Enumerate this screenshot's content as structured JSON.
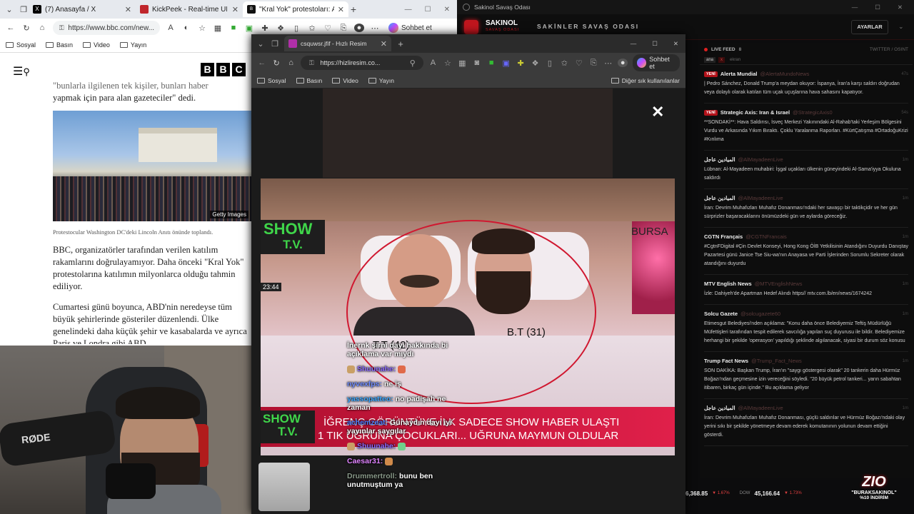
{
  "bbc_window": {
    "tabs": [
      {
        "label": "(7) Anasayfa / X"
      },
      {
        "label": "KickPeek - Real-time URL Crawl"
      },
      {
        "label": "\"Kral Yok\" protestoları: ABD ge"
      }
    ],
    "url": "https://www.bbc.com/new...",
    "sohbet": "Sohbet et",
    "bookmarks": [
      "Sosyal",
      "Basın",
      "Video",
      "Yayın"
    ],
    "logo_letters": [
      "B",
      "B",
      "C"
    ],
    "article": {
      "quote_line1": "\"bunlarla ilgilenen tek kişiler, bunları haber",
      "quote_line2": "yapmak için para alan gazeteciler\" dedi.",
      "image_credit": "Getty Images",
      "caption": "Protestocular Washington DC'deki Lincoln Anıtı önünde toplandı.",
      "p1": "BBC, organizatörler tarafından verilen katılım rakamlarını doğrulayamıyor. Daha önceki \"Kral Yok\" protestolarına katılımın milyonlarca olduğu tahmin ediliyor.",
      "p2": "Cumartesi günü boyunca, ABD'nin neredeyse tüm büyük şehirlerinde gösteriler düzenlendi. Ülke genelindeki daha küçük şehir ve kasabalarda ve ayrıca Paris ve Londra gibi ABD"
    }
  },
  "webcam": {
    "mic_label": "RØDE"
  },
  "viewer_window": {
    "tab_label": "csquwsr.jfif - Hızlı Resim",
    "url": "https://hizliresim.co...",
    "sohbet": "Sohbet et",
    "bookmarks": [
      "Sosyal",
      "Basın",
      "Video",
      "Yayın"
    ],
    "other_bookmarks": "Diğer sık kullanılanlar",
    "image": {
      "logo_top": "SHOW",
      "logo_bottom": "T.V.",
      "city": "BURSA",
      "label_left": "T.T (42)",
      "label_right": "B.T (31)",
      "clock": "23:44",
      "banner_line1": "İĞRENÇ GÖRÜNTÜYE İLK SADECE SHOW HABER ULAŞTI",
      "banner_line2": "1 TIK UĞRUNA ÇOCUKLARI... UĞRUNA MAYMUN OLDULAR"
    }
  },
  "chat": [
    {
      "user": "",
      "text": "İnernk şirni dayı hakkında bi açıklama var mıydı",
      "color": "#ffffff"
    },
    {
      "user": "Shuunahe:",
      "text": "",
      "color": "#8c6cff"
    },
    {
      "user": "nyvexfps:",
      "text": "ne iş",
      "color": "#6f8cff"
    },
    {
      "user": "yassopatteo:",
      "text": "no padişah ne zaman",
      "color": "#3aa7ff"
    },
    {
      "user": "achemzeat:",
      "text": "Günaydın dayı iyi yayınlar saygılar",
      "color": "#4e7cff"
    },
    {
      "user": "Shuunahe:",
      "text": "",
      "color": "#8c6cff"
    },
    {
      "user": "Caesar31:",
      "text": "",
      "color": "#e084ff"
    },
    {
      "user": "Drummertroll:",
      "text": "bunu ben unutmuştum ya",
      "color": "#8a9a8a"
    }
  ],
  "war_room": {
    "window_title": "Sakinol Savaş Odası",
    "brand": "SAKINOL",
    "brand_sub": "SAVAŞ ODASI",
    "header_title": "SAKİNLER SAVAŞ ODASI",
    "settings_button": "AYARLAR",
    "live_feed": "LIVE FEED",
    "live_count": "8",
    "feed_right": "TWITTER / OSINT",
    "filters": [
      "ana",
      "x",
      "ekran"
    ],
    "feed": [
      {
        "new": "YENİ",
        "source": "Alerta Mundial",
        "handle": "@AlertaMundoNews",
        "time": "47s",
        "text": "| Pedro Sánchez, Donald Trump'a meydan okuyor: İspanya, İran'a karşı saldırı doğrudan veya dolaylı olarak katılan tüm uçak uçuşlarına hava sahasını kapatıyor."
      },
      {
        "new": "YENİ",
        "source": "Strategic Axis: Iran & Israel",
        "handle": "@StrategicAxis0",
        "time": "54s",
        "text": "**SONDAKİ**: Hava Saldırısı, İsveç Merkezi Yakınındaki Al-Rahab'taki Yerleşim Bölgesini Vurdu ve Arkasında Yıkım Bıraktı. Çoklu Yaralanma Raporları. #KürtÇatışma #OrtadoğuKrizi #Kınlıma"
      },
      {
        "new": "",
        "source": "الميادين عاجل",
        "handle": "@AlMayadeenLive",
        "time": "1m",
        "text": "Lübnan: Al-Mayadeen muhabiri: İşgal uçakları ülkenin güneyindeki Al-Sama'iyya Okuluna saldırdı"
      },
      {
        "new": "",
        "source": "الميادين عاجل",
        "handle": "@AlMayadeenLive",
        "time": "1m",
        "text": "İran: Devrim Muhafızları Muhafız Donanması'ndaki her savaşçı bir taktikçidir ve her gün sürprizler başaracaklarını önümüzdeki gün ve aylarda göreceğiz."
      },
      {
        "new": "",
        "source": "CGTN Français",
        "handle": "@CGTNFrancais",
        "time": "1m",
        "text": "#CgtnFDigital #Çin Devlet Konseyi, Hong Kong ÖİB Yetkilisinin Atandığını Duyurdu Danıştay Pazartesi günü Janice Tse Siu-wa'nın Anayasa ve Parti İşlerinden Sorumlu Sekreter olarak atandığını duyurdu"
      },
      {
        "new": "",
        "source": "MTV English News",
        "handle": "@MTVEnglishNews",
        "time": "1m",
        "text": "İzle: Dahiyeh'de Apartman Hedef Alındı https// mtv.com.lb/en/news/1674242"
      },
      {
        "new": "",
        "source": "Solcu Gazete",
        "handle": "@solcugazete60",
        "time": "1m",
        "text": "Etimesgut Belediyesi'nden açıklama: \"Konu daha önce Belediyemiz Teftiş Müdürlüğü Müfettişleri tarafından tespit edilerek savcılığa yapılan suç duyurusu ile bildir. Belediyemize herhangi bir şekilde 'operasyon' yapıldığı şeklinde algılanacak, siyasi bir durum söz konusu"
      },
      {
        "new": "",
        "source": "Trump Fact News",
        "handle": "@Trump_Fact_News",
        "time": "1m",
        "text": "SON DAKİKA: Başkan Trump, İran'ın \"saygı göstergesi olarak\" 20 tankerin daha Hürmüz Boğazı'ndan geçmesine izin vereceğini söyledi. \"20 büyük petrol tankeri... yarın sabahtan itibaren, birkaç gün içinde.\" Bu açıklama geliyor"
      },
      {
        "new": "",
        "source": "الميادين عاجل",
        "handle": "@AlMayadeenLive",
        "time": "1m",
        "text": "İran: Devrim Muhafızları Muhafız Donanması, güçlü saldırılar ve Hürmüz Boğazı'ndaki olay yerini sıkı bir şekilde yönetmeye devam ederek komutanının yolunun devam ettiğini gösterdi."
      }
    ],
    "ticker": [
      {
        "value": "6,368.85",
        "change": "▼ 1.67%",
        "name": "DOW"
      },
      {
        "value": "45,166.64",
        "change": "▼ 1.73%",
        "name": ""
      }
    ],
    "promo_logo": "ZIO",
    "promo_code": "\"BURAKSAKINOL\"",
    "promo_discount": "%10 İNDİRİM"
  },
  "colors": {
    "bbc_black": "#000000",
    "war_red": "#c0161e",
    "banner_red": "#d3173b"
  }
}
